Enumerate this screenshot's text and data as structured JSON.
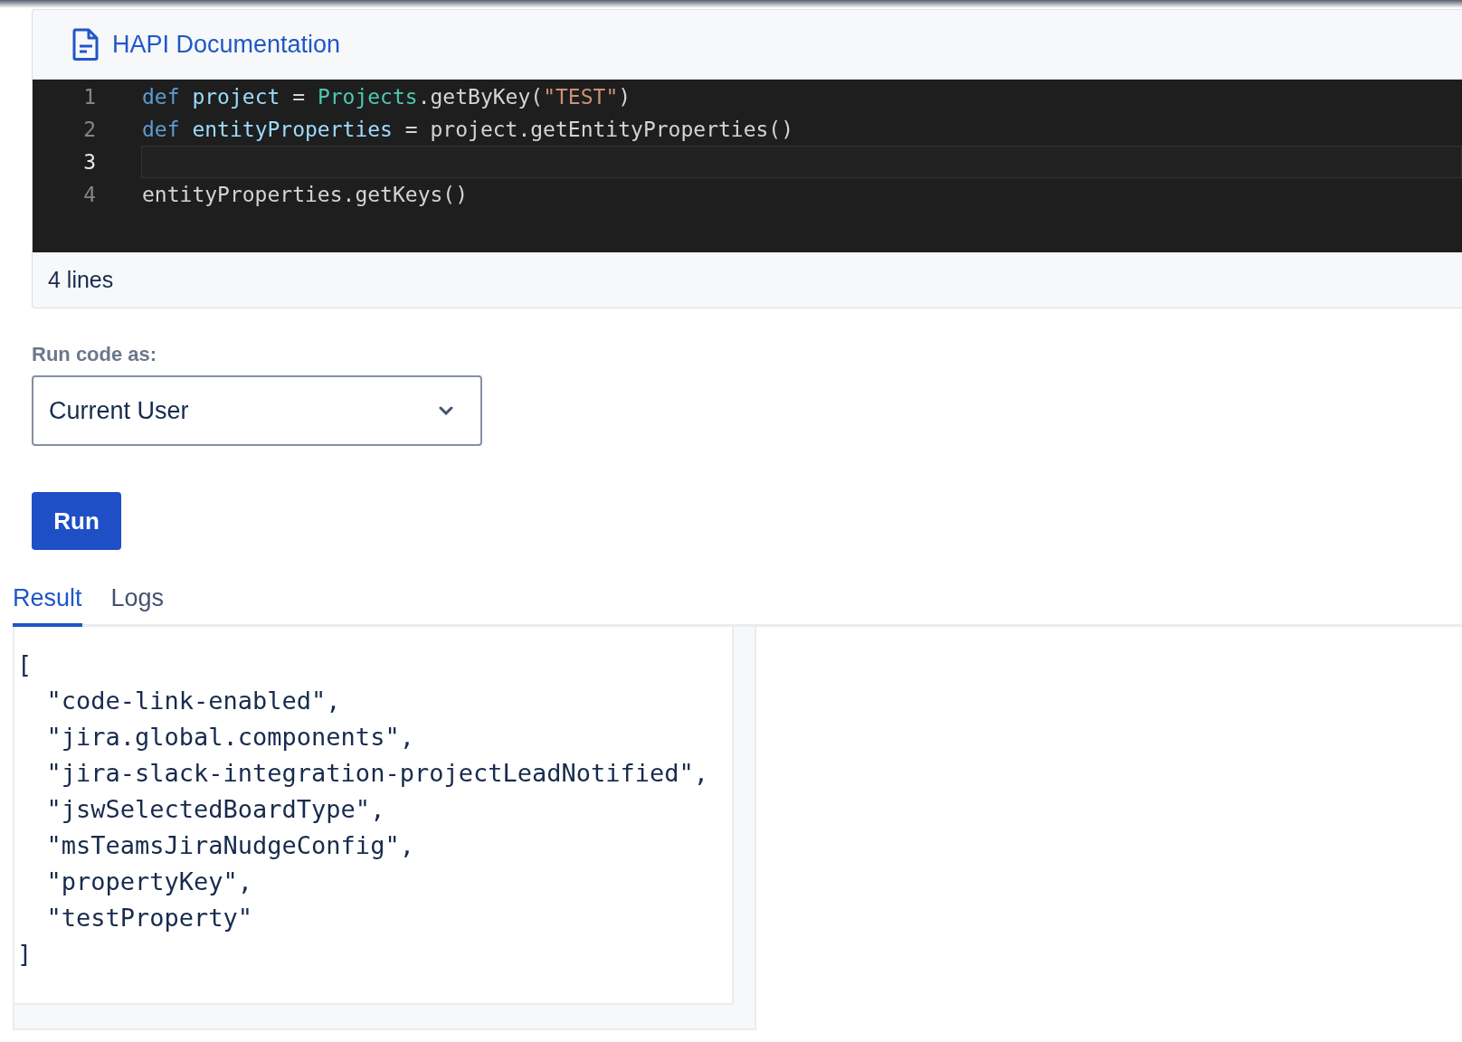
{
  "editor": {
    "title": "HAPI Documentation",
    "lines": [
      {
        "number": "1",
        "selected": false,
        "tokens": [
          {
            "kind": "keyword",
            "text": "def "
          },
          {
            "kind": "variable",
            "text": "project"
          },
          {
            "kind": "plain",
            "text": " = "
          },
          {
            "kind": "class",
            "text": "Projects"
          },
          {
            "kind": "plain",
            "text": ".getByKey("
          },
          {
            "kind": "string",
            "text": "\"TEST\""
          },
          {
            "kind": "plain",
            "text": ")"
          }
        ]
      },
      {
        "number": "2",
        "selected": false,
        "tokens": [
          {
            "kind": "keyword",
            "text": "def "
          },
          {
            "kind": "variable",
            "text": "entityProperties"
          },
          {
            "kind": "plain",
            "text": " = project.getEntityProperties()"
          }
        ]
      },
      {
        "number": "3",
        "selected": true
      },
      {
        "number": "4",
        "selected": false,
        "tokens": [
          {
            "kind": "plain",
            "text": "entityProperties.getKeys()"
          }
        ]
      }
    ],
    "line_count": "4 lines"
  },
  "run_as": {
    "label": "Run code as:",
    "value": "Current User"
  },
  "run_button": "Run",
  "tabs": [
    {
      "label": "Result",
      "selected": true
    },
    {
      "label": "Logs",
      "selected": false
    }
  ],
  "result_lines": [
    "[",
    "  \"code-link-enabled\",",
    "  \"jira.global.components\",",
    "  \"jira-slack-integration-projectLeadNotified\",",
    "  \"jswSelectedBoardType\",",
    "  \"msTeamsJiraNudgeConfig\",",
    "  \"propertyKey\",",
    "  \"testProperty\"",
    "]"
  ]
}
